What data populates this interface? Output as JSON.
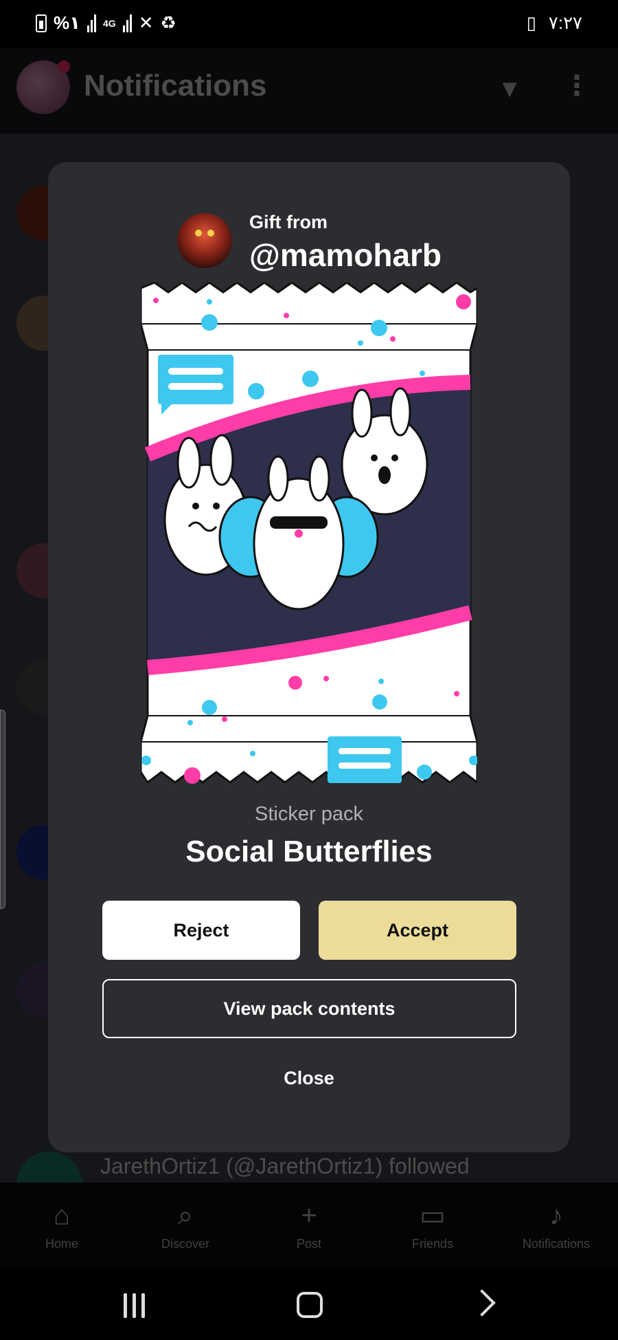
{
  "status_bar": {
    "battery_percent": "%١",
    "network": "4G",
    "time": "٧:٢٧"
  },
  "background": {
    "header_title": "Notifications",
    "filter_icon": "filter-icon",
    "more_icon": "more-vertical-icon",
    "partial_row_text": "JarethOrtiz1 (@JarethOrtiz1) followed",
    "nav_tabs": [
      {
        "label": "Home",
        "icon": "home-icon"
      },
      {
        "label": "Discover",
        "icon": "search-icon"
      },
      {
        "label": "Post",
        "icon": "plus-icon"
      },
      {
        "label": "Friends",
        "icon": "chat-icon"
      },
      {
        "label": "Notifications",
        "icon": "bell-icon"
      }
    ]
  },
  "gift": {
    "from_label": "Gift from",
    "username": "@mamoharb",
    "pack_type": "Sticker pack",
    "pack_name": "Social Butterflies"
  },
  "actions": {
    "reject": "Reject",
    "accept": "Accept",
    "view_contents": "View pack contents",
    "close": "Close"
  },
  "colors": {
    "modal_bg": "#2c2d31",
    "accept_bg": "#ecdc9a",
    "pack_pink": "#ff3da8",
    "pack_cyan": "#3ec8ef"
  }
}
